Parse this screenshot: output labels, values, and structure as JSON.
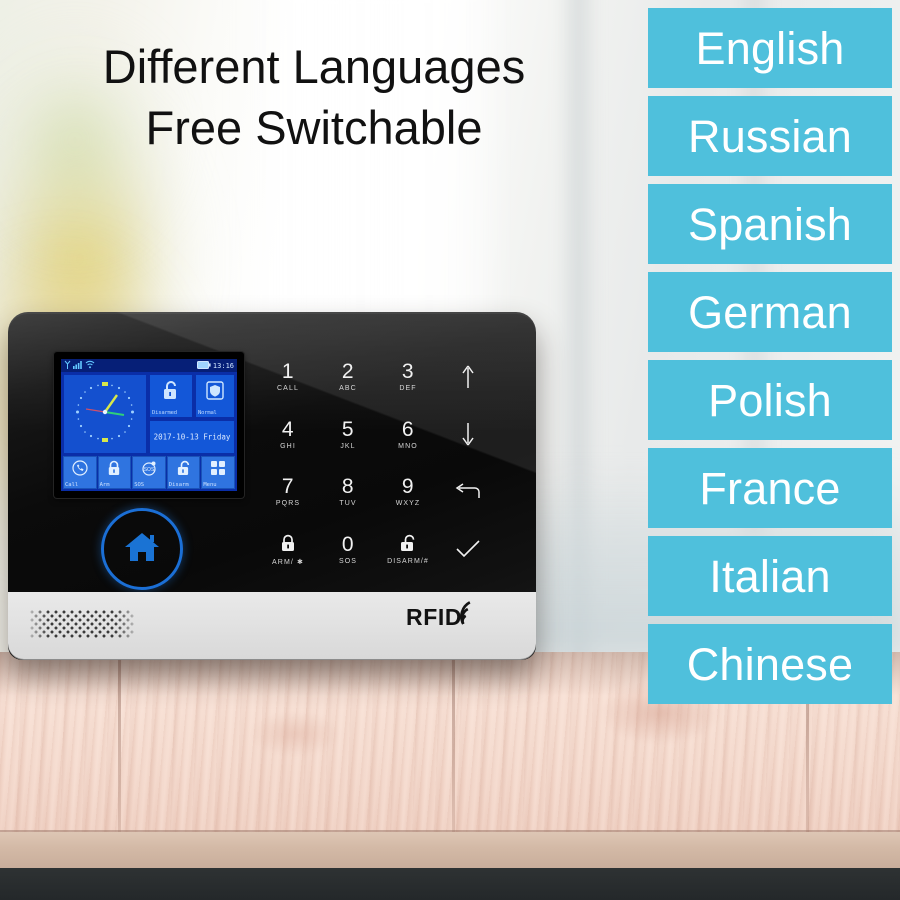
{
  "headline": {
    "line1": "Different Languages",
    "line2": "Free Switchable"
  },
  "colors": {
    "chip_bg": "#4FC0DC",
    "chip_text": "#FFFFFF",
    "headline_text": "#111111",
    "lcd_blue": "#0A2EA8",
    "lcd_tile": "#1357D8",
    "accent_blue": "#1B6FD6",
    "panel_black": "#0B0B0B",
    "panel_base_white": "#E4E4E4",
    "desk_wood": "#F2D6C9"
  },
  "languages": [
    {
      "label": "English"
    },
    {
      "label": "Russian"
    },
    {
      "label": "Spanish"
    },
    {
      "label": "German"
    },
    {
      "label": "Polish"
    },
    {
      "label": "France"
    },
    {
      "label": "Italian"
    },
    {
      "label": "Chinese"
    }
  ],
  "device": {
    "brand_mark": "RFID",
    "home_button_icon": "home-icon",
    "speaker_icon": "speaker-grille",
    "lcd": {
      "status_bar": {
        "antenna_icon": "antenna-icon",
        "signal_icon": "signal-bars-icon",
        "wifi_icon": "wifi-icon",
        "battery_icon": "battery-icon",
        "time": "13:16"
      },
      "tiles": [
        {
          "name": "clock",
          "icon": "analog-clock-icon",
          "label": ""
        },
        {
          "name": "arm-state",
          "icon": "unlocked-padlock-icon",
          "label": "Disarmed"
        },
        {
          "name": "system-state",
          "icon": "shield-icon",
          "label": "Normal"
        },
        {
          "name": "date",
          "icon": "",
          "label": "2017-10-13 Friday"
        }
      ],
      "toolbar": [
        {
          "label": "Call",
          "icon": "phone-icon"
        },
        {
          "label": "Arm",
          "icon": "padlock-closed-icon"
        },
        {
          "label": "SOS",
          "icon": "sos-icon"
        },
        {
          "label": "Disarm",
          "icon": "padlock-open-icon"
        },
        {
          "label": "Menu",
          "icon": "grid-menu-icon"
        }
      ]
    },
    "keypad": [
      {
        "num": "1",
        "sub": "CALL",
        "glyph": ""
      },
      {
        "num": "2",
        "sub": "ABC",
        "glyph": ""
      },
      {
        "num": "3",
        "sub": "DEF",
        "glyph": ""
      },
      {
        "num": "",
        "sub": "",
        "glyph": "arrow-up-icon"
      },
      {
        "num": "4",
        "sub": "GHI",
        "glyph": ""
      },
      {
        "num": "5",
        "sub": "JKL",
        "glyph": ""
      },
      {
        "num": "6",
        "sub": "MNO",
        "glyph": ""
      },
      {
        "num": "",
        "sub": "",
        "glyph": "arrow-down-icon"
      },
      {
        "num": "7",
        "sub": "PQRS",
        "glyph": ""
      },
      {
        "num": "8",
        "sub": "TUV",
        "glyph": ""
      },
      {
        "num": "9",
        "sub": "WXYZ",
        "glyph": ""
      },
      {
        "num": "",
        "sub": "",
        "glyph": "back-arrow-icon"
      },
      {
        "num": "",
        "sub": "ARM/ ✱",
        "glyph": "padlock-closed-icon"
      },
      {
        "num": "0",
        "sub": "SOS",
        "glyph": ""
      },
      {
        "num": "",
        "sub": "DISARM/#",
        "glyph": "padlock-open-icon"
      },
      {
        "num": "",
        "sub": "",
        "glyph": "checkmark-icon"
      }
    ]
  }
}
